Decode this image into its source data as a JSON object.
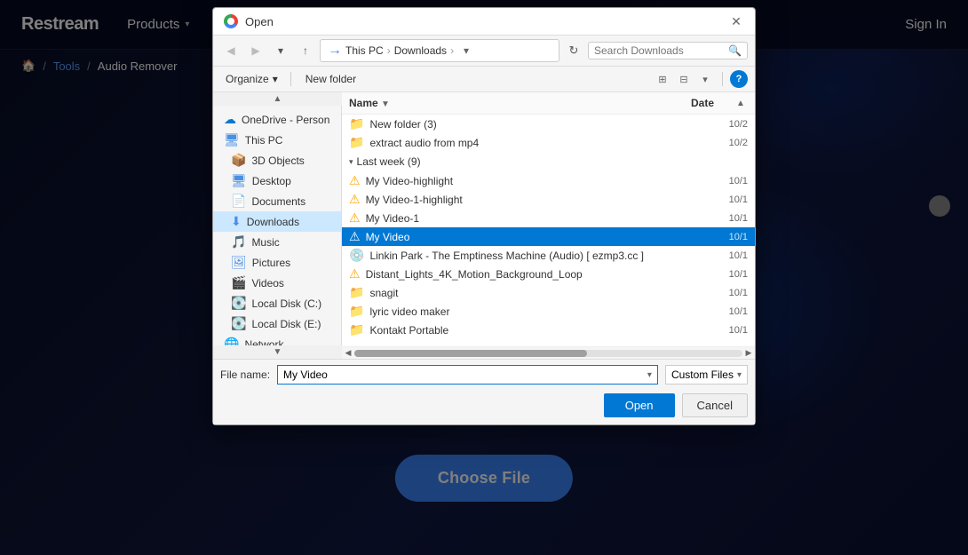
{
  "app": {
    "logo": "Restream",
    "nav": {
      "products_label": "Products",
      "signin_label": "Sign In"
    },
    "breadcrumb": {
      "home": "🏠",
      "tools": "Tools",
      "current": "Audio Remover"
    },
    "choose_file_label": "Choose File"
  },
  "dialog": {
    "title": "Open",
    "close_icon": "✕",
    "toolbar": {
      "back_icon": "←",
      "forward_icon": "→",
      "down_icon": "↓",
      "up_icon": "↑",
      "path_parts": [
        "This PC",
        "Downloads"
      ],
      "path_arrow": "→",
      "refresh_icon": "↻",
      "search_placeholder": "Search Downloads",
      "search_icon": "🔍"
    },
    "content_toolbar": {
      "organize_label": "Organize",
      "organize_chevron": "▾",
      "new_folder_label": "New folder",
      "view_icon1": "⊞",
      "view_icon2": "⊟",
      "help_label": "?"
    },
    "left_panel": {
      "items": [
        {
          "icon": "☁",
          "label": "OneDrive - Person",
          "selected": false,
          "id": "onedrive"
        },
        {
          "icon": "🖥",
          "label": "This PC",
          "selected": false,
          "id": "this-pc"
        },
        {
          "icon": "📦",
          "label": "3D Objects",
          "selected": false,
          "id": "3d-objects",
          "indent": true
        },
        {
          "icon": "🖥",
          "label": "Desktop",
          "selected": false,
          "id": "desktop",
          "indent": true
        },
        {
          "icon": "📄",
          "label": "Documents",
          "selected": false,
          "id": "documents",
          "indent": true
        },
        {
          "icon": "⬇",
          "label": "Downloads",
          "selected": true,
          "id": "downloads",
          "indent": true
        },
        {
          "icon": "🎵",
          "label": "Music",
          "selected": false,
          "id": "music",
          "indent": true
        },
        {
          "icon": "🖼",
          "label": "Pictures",
          "selected": false,
          "id": "pictures",
          "indent": true
        },
        {
          "icon": "🎬",
          "label": "Videos",
          "selected": false,
          "id": "videos",
          "indent": true
        },
        {
          "icon": "💽",
          "label": "Local Disk (C:)",
          "selected": false,
          "id": "local-disk-c",
          "indent": true
        },
        {
          "icon": "💽",
          "label": "Local Disk (E:)",
          "selected": false,
          "id": "local-disk-e",
          "indent": true
        },
        {
          "icon": "🌐",
          "label": "Network",
          "selected": false,
          "id": "network"
        }
      ]
    },
    "right_panel": {
      "col_name": "Name",
      "col_date": "Date",
      "recent_header": "▾  Last week (9)",
      "files_top": [
        {
          "icon": "📁",
          "label": "New folder (3)",
          "date": "10/2"
        },
        {
          "icon": "📁",
          "label": "extract audio from mp4",
          "date": "10/2"
        }
      ],
      "files": [
        {
          "icon": "⚠",
          "label": "My Video-highlight",
          "date": "10/1",
          "selected": false,
          "icon_color": "orange"
        },
        {
          "icon": "⚠",
          "label": "My Video-1-highlight",
          "date": "10/1",
          "selected": false,
          "icon_color": "orange"
        },
        {
          "icon": "⚠",
          "label": "My Video-1",
          "date": "10/1",
          "selected": false,
          "icon_color": "orange"
        },
        {
          "icon": "⚠",
          "label": "My Video",
          "date": "10/1",
          "selected": true,
          "icon_color": "orange"
        },
        {
          "icon": "💿",
          "label": "Linkin Park - The Emptiness Machine (Audio) [ ezmp3.cc ]",
          "date": "10/1",
          "selected": false
        },
        {
          "icon": "⚠",
          "label": "Distant_Lights_4K_Motion_Background_Loop",
          "date": "10/1",
          "selected": false,
          "icon_color": "orange"
        },
        {
          "icon": "📁",
          "label": "snagit",
          "date": "10/1",
          "selected": false
        },
        {
          "icon": "📁",
          "label": "lyric video maker",
          "date": "10/1",
          "selected": false
        },
        {
          "icon": "📁",
          "label": "Kontakt Portable",
          "date": "10/1",
          "selected": false
        }
      ]
    },
    "bottom": {
      "filename_label": "File name:",
      "filename_value": "My Video",
      "filetype_label": "Custom Files",
      "open_label": "Open",
      "cancel_label": "Cancel"
    }
  }
}
